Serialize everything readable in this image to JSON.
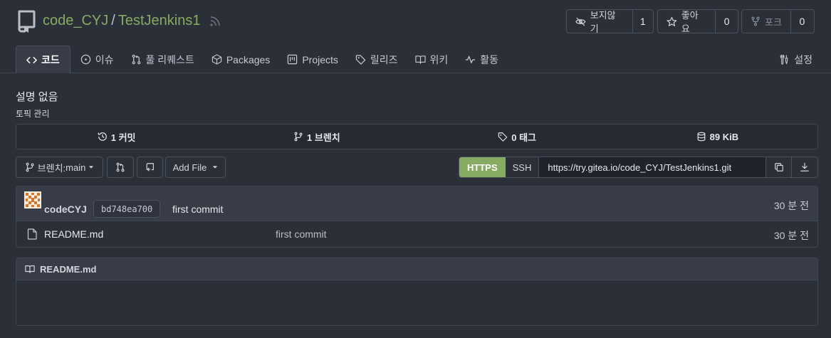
{
  "repo": {
    "owner": "code_CYJ",
    "separator": "/",
    "name": "TestJenkins1"
  },
  "actions": {
    "watch": {
      "label": "보지않기",
      "count": "1"
    },
    "star": {
      "label": "좋아요",
      "count": "0"
    },
    "fork": {
      "label": "포크",
      "count": "0"
    }
  },
  "tabs": [
    {
      "label": "코드",
      "icon": "code-icon",
      "active": true
    },
    {
      "label": "이슈",
      "icon": "issue-icon"
    },
    {
      "label": "풀 리퀘스트",
      "icon": "pull-request-icon"
    },
    {
      "label": "Packages",
      "icon": "package-icon"
    },
    {
      "label": "Projects",
      "icon": "project-icon"
    },
    {
      "label": "릴리즈",
      "icon": "tag-icon"
    },
    {
      "label": "위키",
      "icon": "book-icon"
    },
    {
      "label": "활동",
      "icon": "pulse-icon"
    },
    {
      "label": "설정",
      "icon": "tools-icon"
    }
  ],
  "description": "설명 없음",
  "topics_link": "토픽 관리",
  "stats": {
    "commits": "1 커밋",
    "branches": "1 브렌치",
    "tags": "0 태그",
    "size": "89 KiB"
  },
  "toolbar": {
    "branch_label": "브렌치:",
    "branch_name": "main",
    "add_file": "Add File"
  },
  "clone": {
    "https": "HTTPS",
    "ssh": "SSH",
    "url": "https://try.gitea.io/code_CYJ/TestJenkins1.git"
  },
  "latest_commit": {
    "author": "codeCYJ",
    "sha": "bd748ea700",
    "message": "first commit",
    "time": "30 분 전"
  },
  "files": [
    {
      "name": "README.md",
      "message": "first commit",
      "time": "30 분 전"
    }
  ],
  "readme": {
    "title": "README.md"
  },
  "colors": {
    "accent": "#87ab63",
    "background": "#2b2f38"
  }
}
